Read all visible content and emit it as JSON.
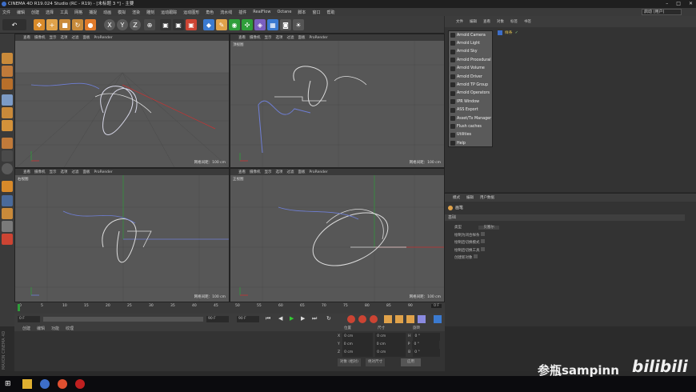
{
  "window": {
    "title": "CINEMA 4D R19.024 Studio (RC - R19) - [未标题 3 *] - 主要"
  },
  "menubar": {
    "items": [
      "文件",
      "编辑",
      "创建",
      "选择",
      "工具",
      "网格",
      "捕捉",
      "动画",
      "模拟",
      "渲染",
      "雕刻",
      "运动跟踪",
      "运动图形",
      "角色",
      "流水线",
      "插件",
      "RealFlow",
      "Octane",
      "脚本",
      "窗口",
      "帮助"
    ],
    "layout_label": "界面",
    "layout_value": "启动 (用户)"
  },
  "viewports": [
    {
      "name": "透视视图",
      "menu": [
        "查看",
        "摄像机",
        "显示",
        "选项",
        "过滤",
        "面板",
        "ProRender"
      ],
      "grid": "网格间距：100 cm"
    },
    {
      "name": "顶视图",
      "menu": [
        "查看",
        "摄像机",
        "显示",
        "选项",
        "过滤",
        "面板",
        "ProRender"
      ],
      "grid": "网格间距：100 cm"
    },
    {
      "name": "右视图",
      "menu": [
        "查看",
        "摄像机",
        "显示",
        "选项",
        "过滤",
        "面板",
        "ProRender"
      ],
      "grid": "网格间距：100 cm"
    },
    {
      "name": "正视图",
      "menu": [
        "查看",
        "摄像机",
        "显示",
        "选项",
        "过滤",
        "面板",
        "ProRender"
      ],
      "grid": "网格间距：100 cm"
    }
  ],
  "object_manager": {
    "tabs": [
      "文件",
      "编辑",
      "查看",
      "对象",
      "标签",
      "书签"
    ],
    "object": "样条"
  },
  "plugin_menu": {
    "items": [
      "Arnold Camera",
      "Arnold Light",
      "Arnold Sky",
      "Arnold Procedural",
      "Arnold Volume",
      "Arnold Driver",
      "Arnold TP Group",
      "Arnold Operators",
      "IPR Window",
      "ASS Export",
      "Asset/Tx Manager",
      "Flush caches",
      "Utilities",
      "Help"
    ]
  },
  "attributes": {
    "tabs": [
      "模式",
      "编辑",
      "用户数据"
    ],
    "title": "画笔",
    "section": "基础",
    "rows": [
      {
        "label": "类型",
        "value": "贝塞尔"
      },
      {
        "label": "绘制为闭合样条",
        "value": ""
      },
      {
        "label": "绘制后切换模式",
        "value": ""
      },
      {
        "label": "绘制后切换工具",
        "value": ""
      },
      {
        "label": "创建新对象",
        "value": ""
      }
    ]
  },
  "timeline": {
    "ticks": [
      "0",
      "5",
      "10",
      "15",
      "20",
      "25",
      "30",
      "35",
      "40",
      "45",
      "50",
      "55",
      "60",
      "65",
      "70",
      "75",
      "80",
      "85",
      "90"
    ],
    "current": "0 F",
    "start": "0 F",
    "end": "90 F",
    "end2": "90 F"
  },
  "material_manager": {
    "tabs": [
      "创建",
      "编辑",
      "功能",
      "纹理"
    ]
  },
  "coordinates": {
    "headers": [
      "位置",
      "尺寸",
      "旋转"
    ],
    "rows": [
      {
        "axis": "X",
        "pos": "0 cm",
        "size": "0 cm",
        "rlabel": "H",
        "rot": "0 °"
      },
      {
        "axis": "Y",
        "pos": "0 cm",
        "size": "0 cm",
        "rlabel": "P",
        "rot": "0 °"
      },
      {
        "axis": "Z",
        "pos": "0 cm",
        "size": "0 cm",
        "rlabel": "B",
        "rot": "0 °"
      }
    ],
    "mode1": "对象 (相对)",
    "mode2": "绝对尺寸",
    "apply": "应用"
  },
  "watermark": {
    "text": "参瓶sampinn"
  },
  "brand": {
    "logo": "MAXON CINEMA 4D"
  },
  "colors": {
    "accent": "#3d6ec9",
    "axis_red": "#c83232",
    "axis_green": "#2f9e3a",
    "spline_blue": "#6f7fd6"
  }
}
